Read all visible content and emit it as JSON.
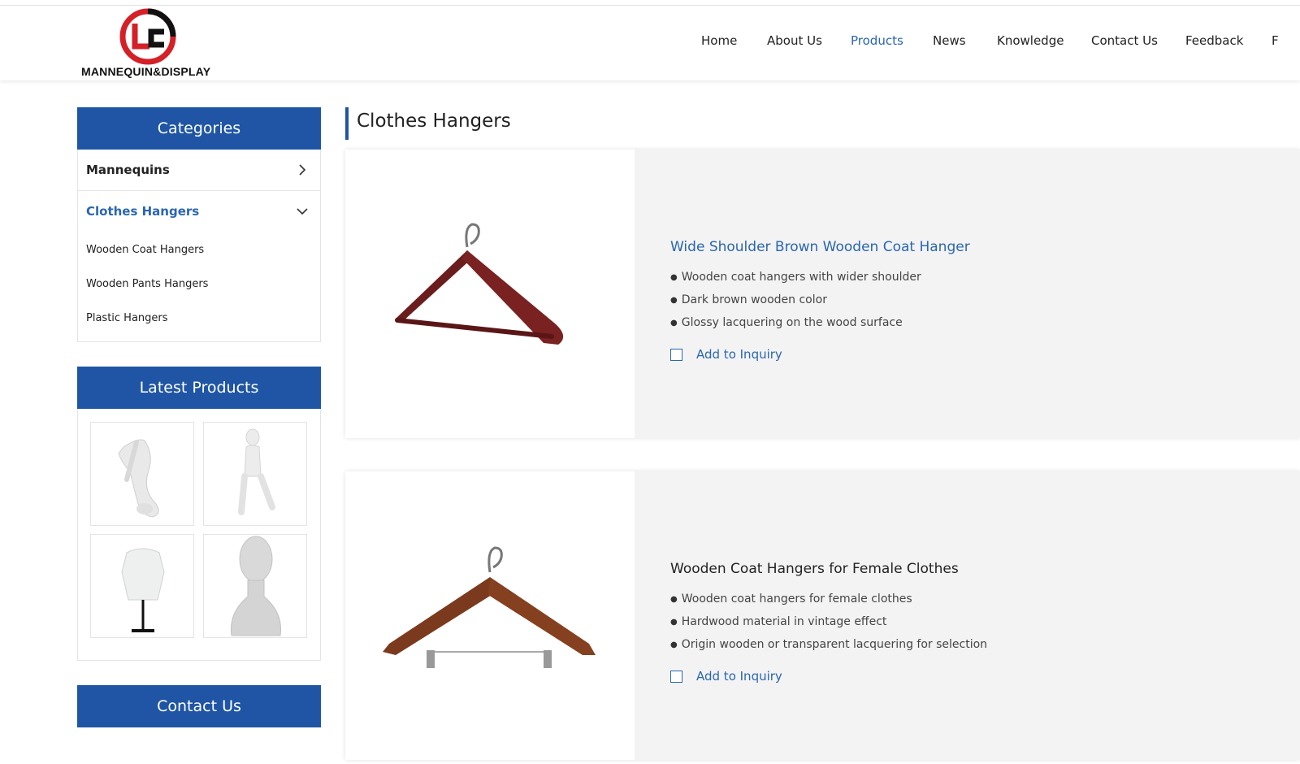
{
  "header": {
    "logo_text": "MANNEQUIN&DISPLAY",
    "nav": [
      {
        "label": "Home",
        "active": false
      },
      {
        "label": "About Us",
        "active": false
      },
      {
        "label": "Products",
        "active": true
      },
      {
        "label": "News",
        "active": false
      },
      {
        "label": "Knowledge",
        "active": false
      },
      {
        "label": "Contact Us",
        "active": false
      },
      {
        "label": "Feedback",
        "active": false
      },
      {
        "label": "F",
        "active": false
      }
    ]
  },
  "sidebar": {
    "categories_title": "Categories",
    "categories": [
      {
        "label": "Mannequins",
        "icon": "chevron-right-icon"
      },
      {
        "label": "Clothes Hangers",
        "icon": "chevron-down-icon",
        "expanded": true,
        "children": [
          "Wooden Coat Hangers",
          "Wooden Pants Hangers",
          "Plastic Hangers"
        ]
      }
    ],
    "latest_title": "Latest Products",
    "contact_title": "Contact Us"
  },
  "main": {
    "page_title": "Clothes Hangers",
    "products": [
      {
        "title": "Wide Shoulder Brown Wooden Coat Hanger",
        "features": [
          "Wooden coat hangers with wider shoulder",
          "Dark brown wooden color",
          "Glossy lacquering on the wood surface"
        ],
        "inquiry_label": "Add to Inquiry"
      },
      {
        "title": "Wooden Coat Hangers for Female Clothes",
        "features": [
          "Wooden coat hangers for female clothes",
          "Hardwood material in vintage effect",
          "Origin wooden or transparent lacquering for selection"
        ],
        "inquiry_label": "Add to Inquiry"
      }
    ]
  },
  "colors": {
    "brand_blue": "#1f55a4",
    "link_blue": "#2a66b0",
    "logo_red": "#d42027"
  }
}
